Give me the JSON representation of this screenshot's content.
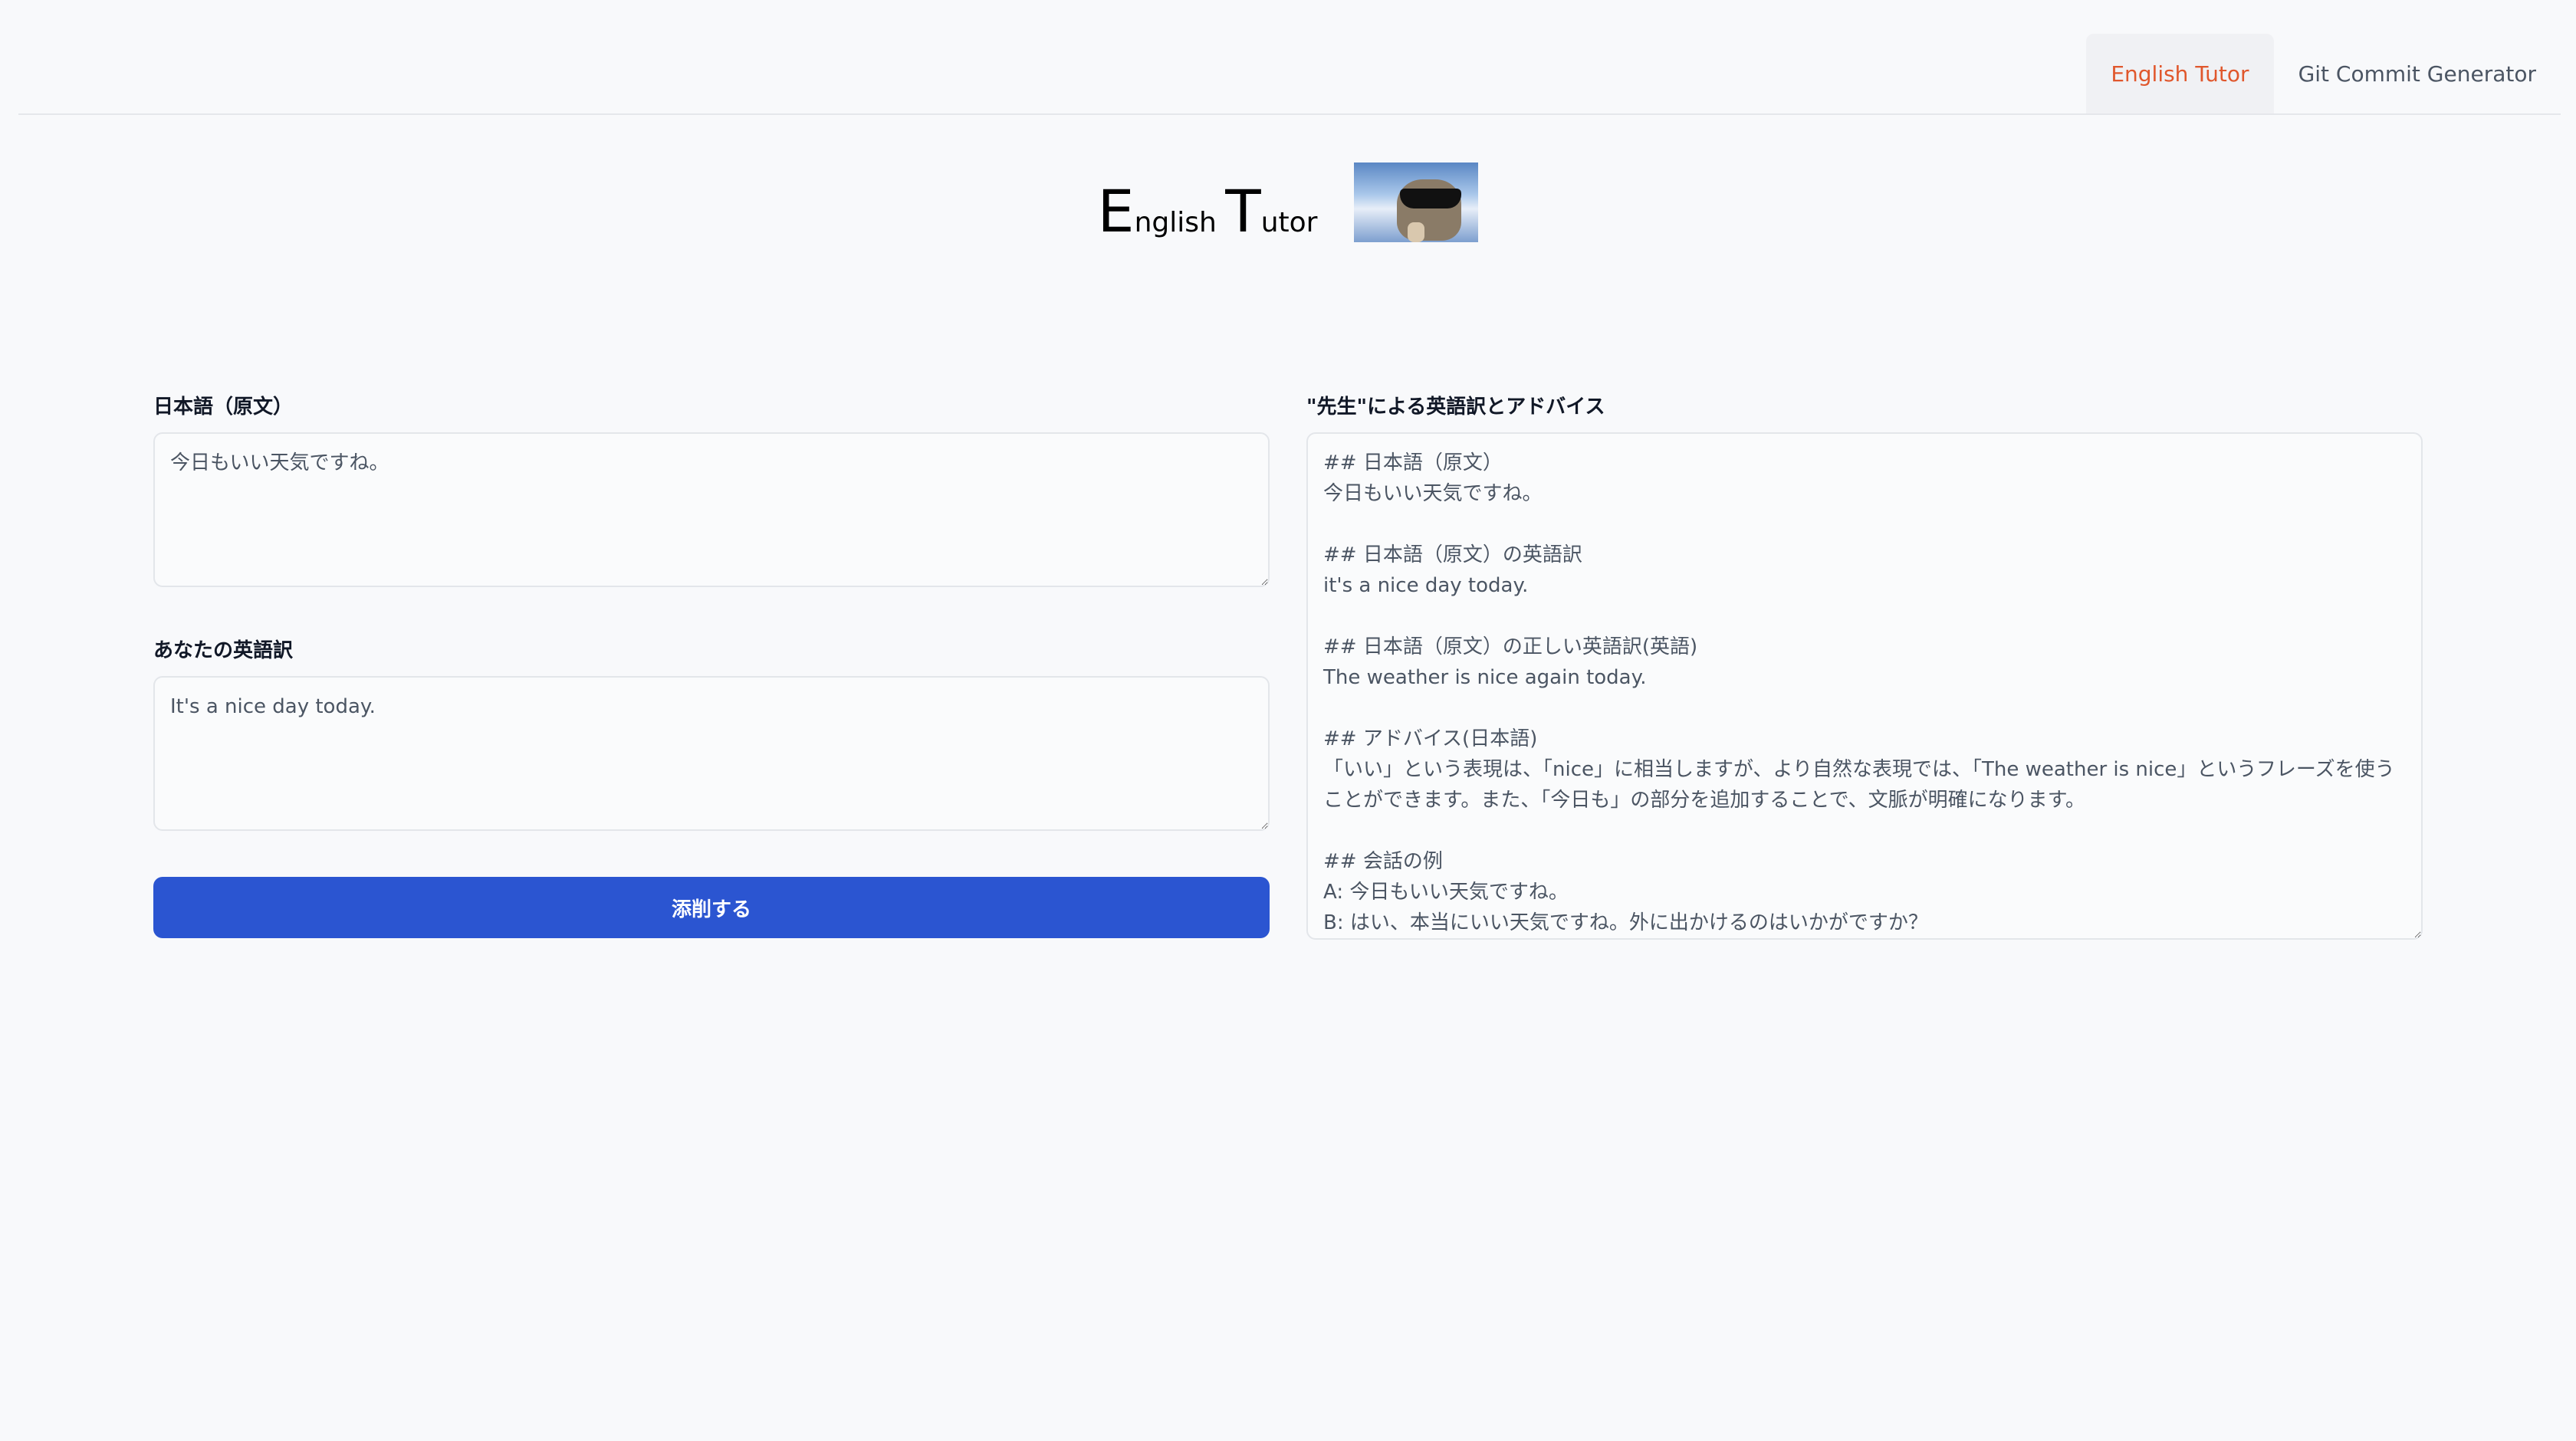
{
  "nav": {
    "tabs": [
      {
        "label": "English Tutor",
        "active": true
      },
      {
        "label": "Git Commit Generator",
        "active": false
      }
    ],
    "active_color": "#e0572c"
  },
  "header": {
    "title_letter_1": "E",
    "title_rest_1": "nglish",
    "title_letter_2": "T",
    "title_rest_2": "utor"
  },
  "form": {
    "original_label": "日本語（原文）",
    "original_value": "今日もいい天気ですね。",
    "translation_label": "あなたの英語訳",
    "translation_value": "It's a nice day today.",
    "submit_label": "添削する",
    "submit_color": "#2b55d1"
  },
  "result": {
    "label": "\"先生\"による英語訳とアドバイス",
    "value": "## 日本語（原文）\n今日もいい天気ですね。\n\n## 日本語（原文）の英語訳\nit's a nice day today.\n\n## 日本語（原文）の正しい英語訳(英語)\nThe weather is nice again today.\n\n## アドバイス(日本語)\n「いい」という表現は、「nice」に相当しますが、より自然な表現では、「The weather is nice」というフレーズを使うことができます。また、「今日も」の部分を追加することで、文脈が明確になります。\n\n## 会話の例\nA: 今日もいい天気ですね。\nB: はい、本当にいい天気ですね。外に出かけるのはいかがですか？"
  }
}
